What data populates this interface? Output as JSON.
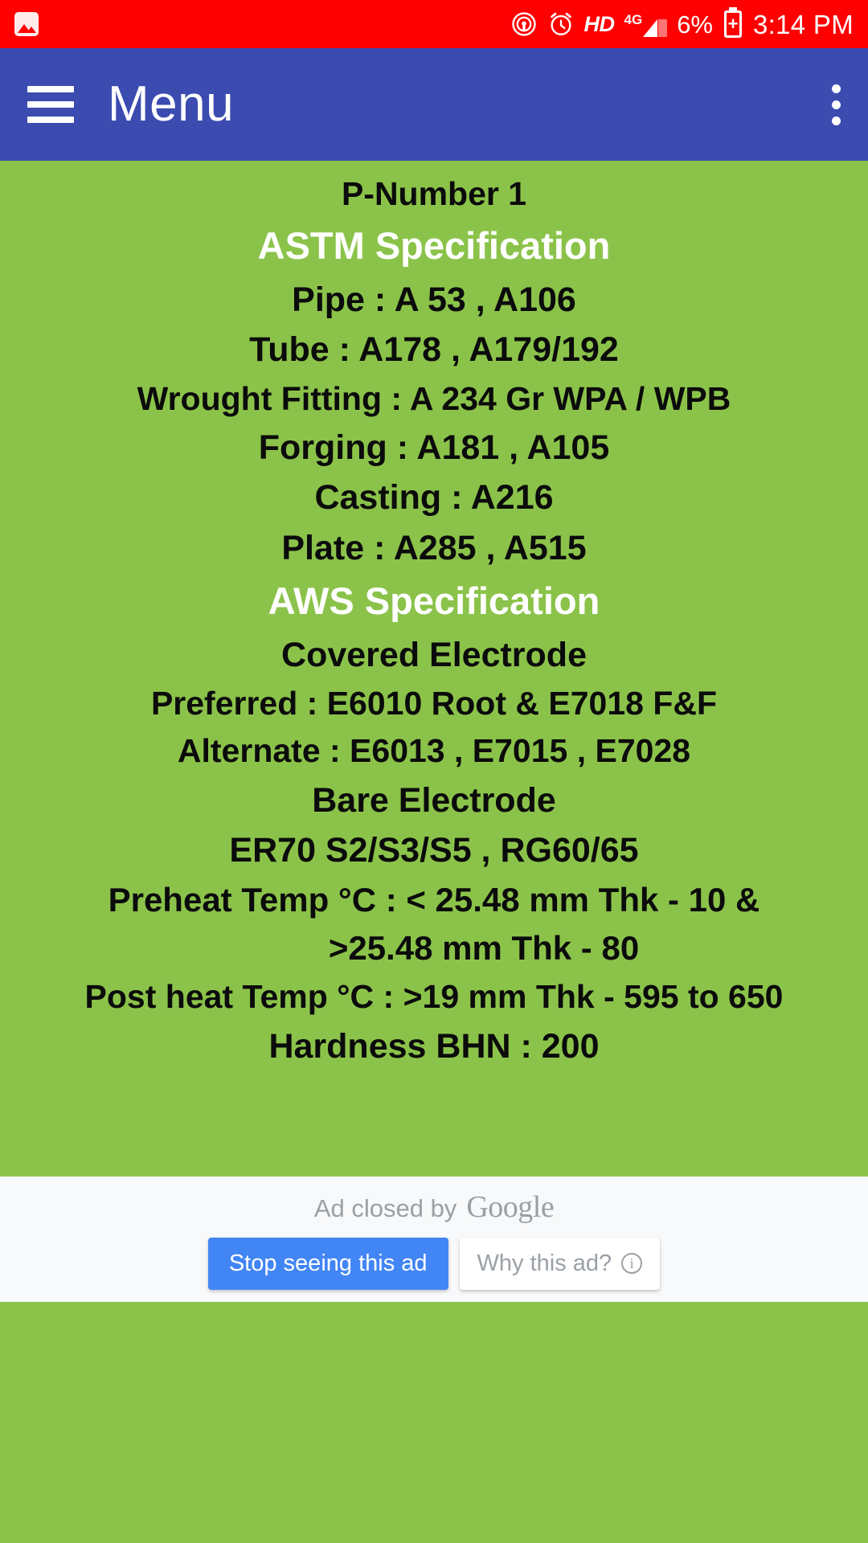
{
  "status_bar": {
    "background_color": "#FE0000",
    "notification_icon": "image-notification-icon",
    "icons": [
      "hotspot-icon",
      "alarm-clock-icon"
    ],
    "hd_label": "HD",
    "network_label": "4G",
    "battery_percent": "6%",
    "battery_state": "charging",
    "time": "3:14 PM"
  },
  "app_bar": {
    "background_color": "#3B4BB0",
    "menu_icon": "hamburger-menu-icon",
    "title": "Menu",
    "overflow_icon": "more-vertical-icon"
  },
  "content": {
    "background_color": "#8BC34A",
    "p_number": "P-Number   1",
    "astm_heading": "ASTM Specification",
    "astm_rows": [
      "Pipe : A 53 , A106",
      "Tube :  A178 , A179/192",
      "Wrought Fitting :  A 234 Gr WPA / WPB",
      "Forging :  A181 , A105",
      "Casting :  A216",
      "Plate :  A285 , A515"
    ],
    "aws_heading": "AWS Specification",
    "covered_electrode_heading": "Covered Electrode",
    "covered_preferred": "Preferred : E6010 Root & E7018 F&F",
    "covered_alternate": "Alternate :  E6013 , E7015 , E7028",
    "bare_electrode_heading": "Bare Electrode",
    "bare_electrode_value": "ER70 S2/S3/S5 , RG60/65",
    "preheat_line1": "Preheat Temp °C :  < 25.48 mm Thk - 10 &",
    "preheat_line2": ">25.48 mm Thk - 80",
    "post_heat": "Post heat Temp °C : >19 mm Thk - 595 to 650",
    "hardness": "Hardness BHN : 200"
  },
  "ad_footer": {
    "background_color": "#F8F9FA",
    "closed_text": "Ad closed by",
    "brand": "Google",
    "stop_button": "Stop seeing this ad",
    "why_button": "Why this ad?",
    "why_icon": "info-icon",
    "stop_button_color": "#4285F4"
  }
}
